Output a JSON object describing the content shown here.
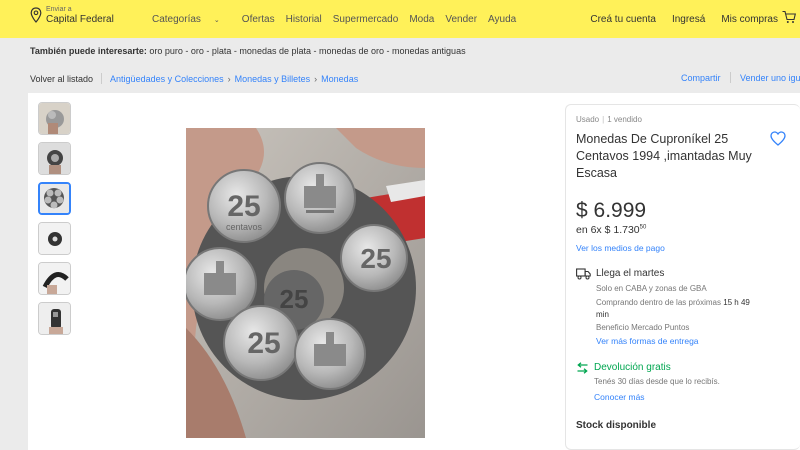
{
  "header": {
    "location_small": "Enviar a",
    "location_main": "Capital Federal",
    "nav": [
      "Categorías",
      "Ofertas",
      "Historial",
      "Supermercado",
      "Moda",
      "Vender",
      "Ayuda"
    ],
    "user_links": [
      "Creá tu cuenta",
      "Ingresá",
      "Mis compras"
    ]
  },
  "related": {
    "label": "También puede interesarte:",
    "items": "oro puro - oro - plata - monedas de plata - monedas de oro - monedas antiguas"
  },
  "breadcrumb": {
    "back": "Volver al listado",
    "items": [
      "Antigüedades y Colecciones",
      "Monedas y Billetes",
      "Monedas"
    ],
    "share": "Compartir",
    "sell_same": "Vender uno igu"
  },
  "product": {
    "condition": "Usado",
    "sold": "1 vendido",
    "title": "Monedas De Cuproníkel 25 Centavos 1994 ,imantadas Muy Escasa",
    "price": "$ 6.999",
    "installments_prefix": "en 6x $ 1.730",
    "installments_cents": "50",
    "payment_link": "Ver los medios de pago"
  },
  "shipping": {
    "title": "Llega el martes",
    "line1": "Solo en CABA y zonas de GBA",
    "line2_prefix": "Comprando dentro de las próximas",
    "line2_time": "15 h 49",
    "line3": "min",
    "line4": "Beneficio Mercado Puntos",
    "link": "Ver más formas de entrega"
  },
  "returns": {
    "title": "Devolución gratis",
    "line": "Tenés 30 días desde que lo recibís.",
    "link": "Conocer más"
  },
  "stock": "Stock disponible",
  "icons": [
    "location-pin-icon",
    "chevron-down-icon",
    "cart-icon",
    "heart-icon",
    "truck-icon",
    "return-arrow-icon"
  ],
  "colors": {
    "header_bg": "#fff159",
    "link": "#3483fa",
    "green": "#00a650"
  }
}
